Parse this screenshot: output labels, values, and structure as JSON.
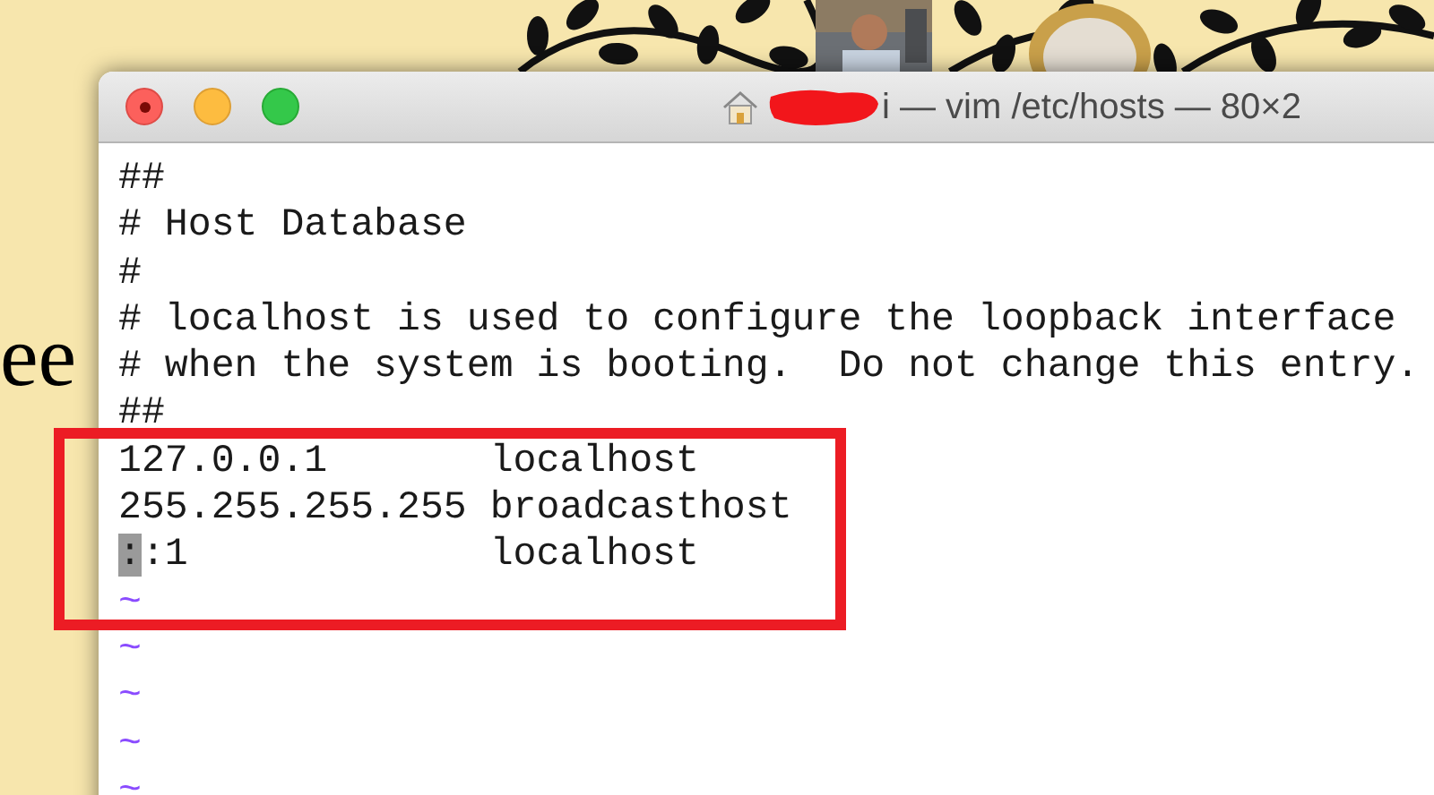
{
  "desktop": {
    "text": "ee"
  },
  "window": {
    "title": "i — vim /etc/hosts — 80×2",
    "lines": [
      {
        "kind": "text",
        "text": "##",
        "cursor": false
      },
      {
        "kind": "text",
        "text": "# Host Database",
        "cursor": false
      },
      {
        "kind": "text",
        "text": "#",
        "cursor": false
      },
      {
        "kind": "text",
        "text": "# localhost is used to configure the loopback interface",
        "cursor": false
      },
      {
        "kind": "text",
        "text": "# when the system is booting.  Do not change this entry.",
        "cursor": false
      },
      {
        "kind": "text",
        "text": "##",
        "cursor": false
      },
      {
        "kind": "text",
        "text": "127.0.0.1       localhost",
        "cursor": false
      },
      {
        "kind": "text",
        "text": "255.255.255.255 broadcasthost",
        "cursor": false
      },
      {
        "kind": "text",
        "text": "::1             localhost",
        "cursor": true
      },
      {
        "kind": "tilde",
        "text": "~"
      },
      {
        "kind": "tilde",
        "text": "~"
      },
      {
        "kind": "tilde",
        "text": "~"
      },
      {
        "kind": "tilde",
        "text": "~"
      },
      {
        "kind": "tilde",
        "text": "~"
      }
    ]
  }
}
